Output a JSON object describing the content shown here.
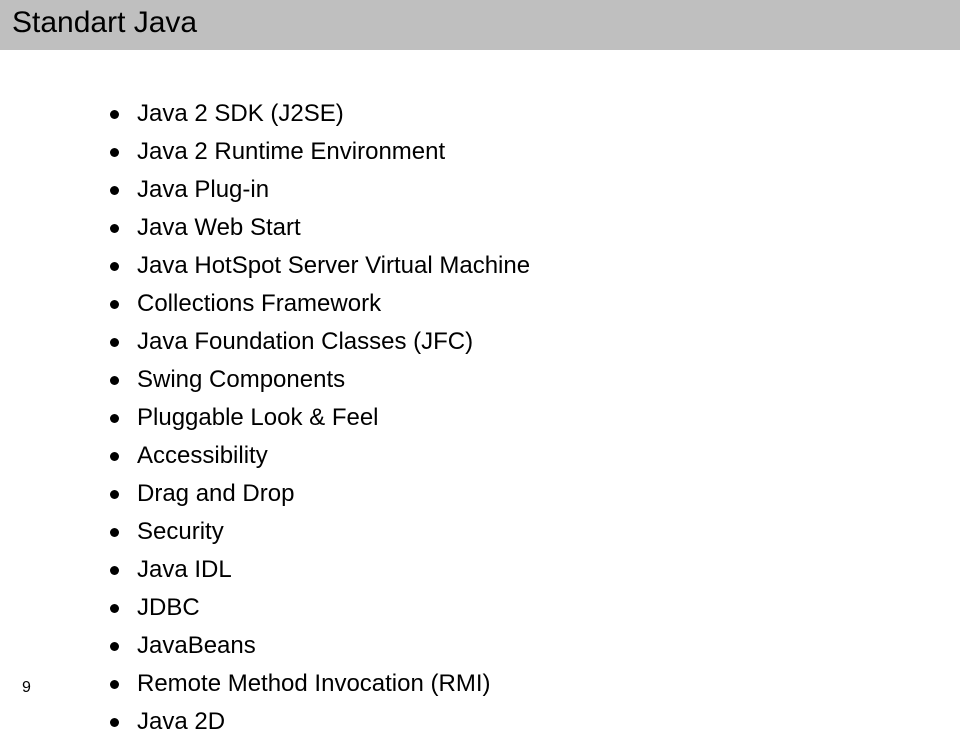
{
  "title": "Standart Java",
  "items": [
    "Java 2 SDK (J2SE)",
    "Java 2 Runtime Environment",
    "Java Plug-in",
    "Java Web Start",
    "Java HotSpot Server Virtual Machine",
    "Collections Framework",
    "Java Foundation Classes (JFC)",
    "Swing Components",
    "Pluggable Look & Feel",
    "Accessibility",
    "Drag and Drop",
    "Security",
    "Java IDL",
    "JDBC",
    "JavaBeans",
    "Remote Method Invocation (RMI)",
    "Java 2D"
  ],
  "pageNumber": "9"
}
